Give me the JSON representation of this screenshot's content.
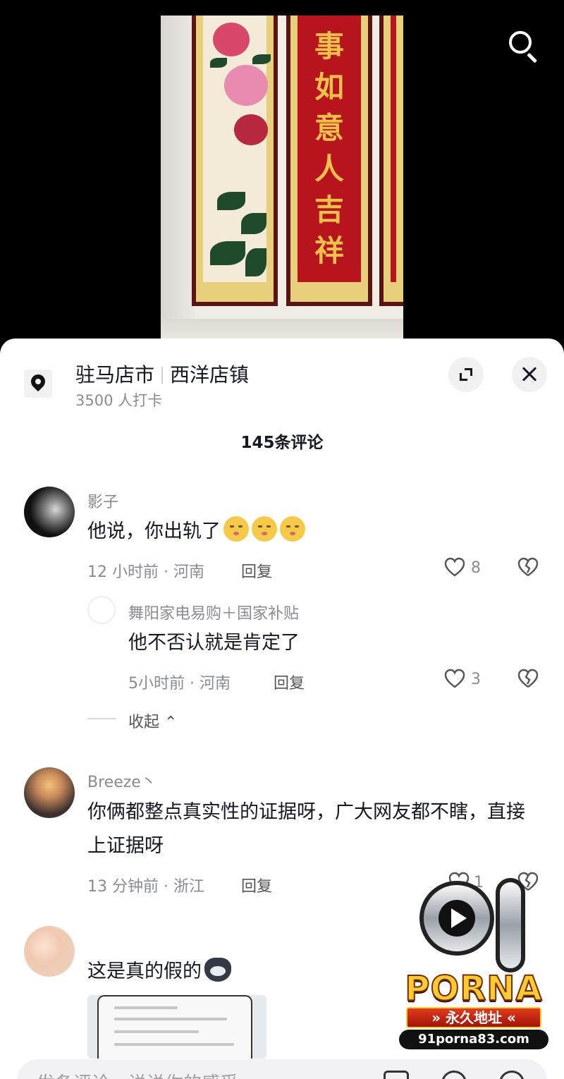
{
  "video": {
    "calligraphy": [
      "事",
      "如",
      "意",
      "人",
      "吉",
      "祥"
    ]
  },
  "location": {
    "city": "驻马店市",
    "town": "西洋店镇",
    "checkins": "3500 人打卡"
  },
  "comments_header": {
    "count_label": "145条评论"
  },
  "comments": [
    {
      "username": "影子",
      "text": "他说，你出轨了",
      "meta": "12 小时前 · 河南",
      "reply_label": "回复",
      "likes": "8"
    },
    {
      "username": "舞阳家电易购＋国家补贴",
      "text": "他不否认就是肯定了",
      "meta": "5小时前 · 河南",
      "reply_label": "回复",
      "likes": "3"
    },
    {
      "username": "Breeze丶",
      "text": "你俩都整点真实性的证据呀，广大网友都不瞎，直接上证据呀",
      "meta": "13 分钟前 · 浙江",
      "reply_label": "回复",
      "likes": "1"
    },
    {
      "username": "",
      "text": "这是真的假的",
      "meta": "",
      "reply_label": "",
      "likes": ""
    }
  ],
  "collapse_label": "收起",
  "input": {
    "placeholder": "发条评论，说说你的感受"
  },
  "watermark": {
    "logo_number": "91",
    "logo_word": "PORNA",
    "ribbon": "永久地址",
    "url": "91porna83.com"
  },
  "colors": {
    "accent_red": "#b8141e",
    "gold": "#f0c14a",
    "text_primary": "#161823",
    "text_secondary": "#8a8b91"
  }
}
